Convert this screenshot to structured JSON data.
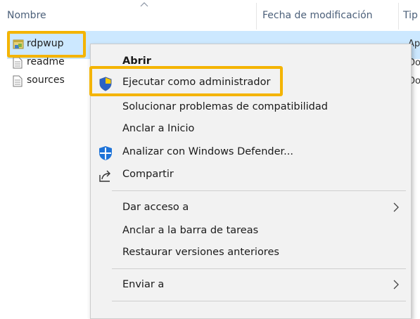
{
  "explorer": {
    "columns": {
      "name": "Nombre",
      "modified": "Fecha de modificación",
      "type": "Tip"
    },
    "files": [
      {
        "name": "rdpwup",
        "type": "Ap",
        "icon": "application-icon",
        "selected": true
      },
      {
        "name": "readme",
        "type": "Do",
        "icon": "text-document-icon",
        "selected": false
      },
      {
        "name": "sources",
        "type": "Do",
        "icon": "text-document-icon",
        "selected": false
      }
    ]
  },
  "context_menu": {
    "items": [
      {
        "label": "Abrir",
        "bold": true
      },
      {
        "label": "Ejecutar como administrador",
        "icon": "uac-shield-icon",
        "highlighted": true
      },
      {
        "label": "Solucionar problemas de compatibilidad"
      },
      {
        "label": "Anclar a Inicio"
      },
      {
        "label": "Analizar con Windows Defender...",
        "icon": "windows-defender-icon"
      },
      {
        "label": "Compartir",
        "icon": "share-icon"
      },
      {
        "label": "Dar acceso a",
        "submenu": true
      },
      {
        "label": "Anclar a la barra de tareas"
      },
      {
        "label": "Restaurar versiones anteriores"
      },
      {
        "label": "Enviar a",
        "submenu": true
      }
    ]
  },
  "colors": {
    "highlight": "#f4b400",
    "selection": "#cce8ff",
    "menu_bg": "#f2f2f2"
  }
}
